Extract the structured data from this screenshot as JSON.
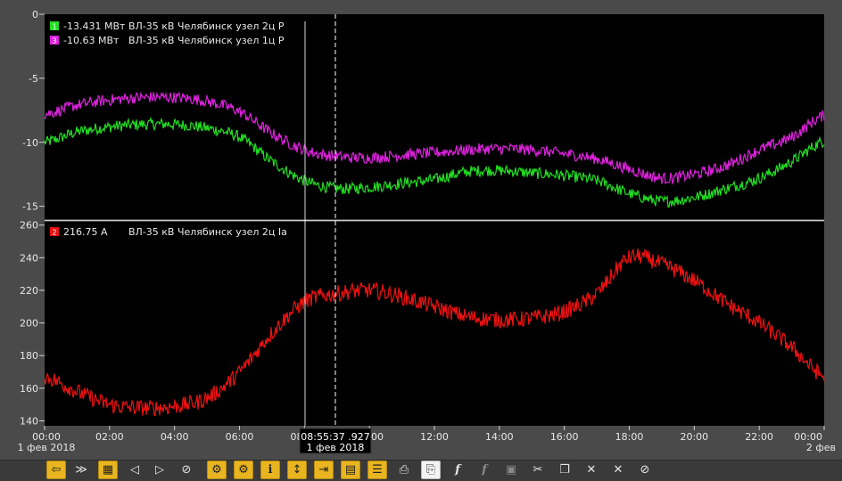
{
  "top_panel": {
    "y_ticks": [
      "0",
      "-5",
      "-10",
      "-15"
    ],
    "legend": [
      {
        "num": "1",
        "value": "-13.431 МВт",
        "name": "ВЛ-35 кВ Челябинск узел 2ц P",
        "color": "#22dd22"
      },
      {
        "num": "3",
        "value": "-10.63 МВт",
        "name": "ВЛ-35 кВ Челябинск узел 1ц P",
        "color": "#dd22dd"
      }
    ]
  },
  "bottom_panel": {
    "y_ticks": [
      "260",
      "240",
      "220",
      "200",
      "180",
      "160",
      "140"
    ],
    "legend": [
      {
        "num": "2",
        "value": "216.75 А",
        "name": "ВЛ-35 кВ Челябинск узел 2ц Ia",
        "color": "#ee1111"
      }
    ]
  },
  "x_axis": {
    "ticks": [
      "00:00",
      "02:00",
      "04:00",
      "06:00",
      "08:00",
      "10:00",
      "12:00",
      "14:00",
      "16:00",
      "18:00",
      "20:00",
      "22:00",
      "00:00"
    ],
    "start_date": "1 фев 2018",
    "end_date": "2 фев",
    "cursor_time": "08:55:37 .927",
    "cursor_date": "1 фев 2018"
  },
  "toolbar": {
    "buttons": [
      {
        "icon": "back-arrow-icon",
        "glyph": "⇦",
        "style": "yellow"
      },
      {
        "icon": "fast-forward-icon",
        "glyph": "≫",
        "style": "plain"
      },
      {
        "icon": "calendar-icon",
        "glyph": "▦",
        "style": "yellow"
      },
      {
        "icon": "step-left-icon",
        "glyph": "◁",
        "style": "plain"
      },
      {
        "icon": "step-right-icon",
        "glyph": "▷",
        "style": "plain"
      },
      {
        "icon": "stop-icon",
        "glyph": "⊘",
        "style": "plain"
      },
      {
        "icon": "settings-document-icon",
        "glyph": "⚙",
        "style": "yellow"
      },
      {
        "icon": "gear-document-icon",
        "glyph": "⚙",
        "style": "yellow"
      },
      {
        "icon": "info-icon",
        "glyph": "ℹ",
        "style": "yellow"
      },
      {
        "icon": "vertical-scale-icon",
        "glyph": "↕",
        "style": "yellow"
      },
      {
        "icon": "import-icon",
        "glyph": "⇥",
        "style": "yellow"
      },
      {
        "icon": "table-icon",
        "glyph": "▤",
        "style": "yellow"
      },
      {
        "icon": "split-view-icon",
        "glyph": "☰",
        "style": "yellow"
      },
      {
        "icon": "print-icon",
        "glyph": "⎙",
        "style": "plain"
      },
      {
        "icon": "export-document-icon",
        "glyph": "⎘",
        "style": "white"
      },
      {
        "icon": "add-formula-icon",
        "glyph": "f",
        "style": "plain"
      },
      {
        "icon": "edit-formula-icon",
        "glyph": "f",
        "style": "dim"
      },
      {
        "icon": "clipboard-icon",
        "glyph": "▣",
        "style": "dim"
      },
      {
        "icon": "scissors-icon",
        "glyph": "✂",
        "style": "plain"
      },
      {
        "icon": "copy-icon",
        "glyph": "❐",
        "style": "plain"
      },
      {
        "icon": "delete-icon",
        "glyph": "✕",
        "style": "plain"
      },
      {
        "icon": "delete-all-icon",
        "glyph": "✕",
        "style": "plain"
      },
      {
        "icon": "hide-icon",
        "glyph": "⊘",
        "style": "plain"
      }
    ]
  },
  "chart_data": [
    {
      "type": "line",
      "title": "",
      "x": [
        0,
        1,
        2,
        3,
        4,
        5,
        6,
        7,
        8,
        9,
        10,
        11,
        12,
        13,
        14,
        15,
        16,
        17,
        18,
        19,
        20,
        21,
        22,
        23,
        24
      ],
      "xlabel": "",
      "ylabel": "",
      "ylim": [
        -16,
        0
      ],
      "series": [
        {
          "name": "ВЛ-35 кВ Челябинск узел 2ц P",
          "color": "#22dd22",
          "values": [
            -10.0,
            -9.2,
            -8.8,
            -8.6,
            -8.6,
            -8.9,
            -9.6,
            -11.5,
            -13.0,
            -13.6,
            -13.5,
            -13.2,
            -12.9,
            -12.3,
            -12.2,
            -12.4,
            -12.6,
            -13.0,
            -14.0,
            -14.6,
            -14.3,
            -13.6,
            -12.8,
            -11.5,
            -9.9
          ]
        },
        {
          "name": "ВЛ-35 кВ Челябинск узел 1ц P",
          "color": "#dd22dd",
          "values": [
            -7.8,
            -7.1,
            -6.7,
            -6.5,
            -6.5,
            -6.8,
            -7.6,
            -9.3,
            -10.6,
            -11.1,
            -11.2,
            -11.0,
            -10.8,
            -10.6,
            -10.5,
            -10.6,
            -10.9,
            -11.3,
            -12.1,
            -12.8,
            -12.5,
            -11.8,
            -10.6,
            -9.6,
            -7.9
          ]
        }
      ]
    },
    {
      "type": "line",
      "title": "",
      "x": [
        0,
        1,
        2,
        3,
        4,
        5,
        6,
        7,
        8,
        9,
        10,
        11,
        12,
        13,
        14,
        15,
        16,
        17,
        18,
        19,
        20,
        21,
        22,
        23,
        24
      ],
      "xlabel": "",
      "ylabel": "",
      "ylim": [
        137,
        262
      ],
      "series": [
        {
          "name": "ВЛ-35 кВ Челябинск узел 2ц Ia",
          "color": "#ee1111",
          "values": [
            167,
            158,
            150,
            148,
            149,
            154,
            170,
            194,
            213,
            218,
            220,
            216,
            210,
            204,
            202,
            203,
            207,
            218,
            240,
            236,
            226,
            212,
            200,
            185,
            167
          ]
        }
      ]
    }
  ]
}
